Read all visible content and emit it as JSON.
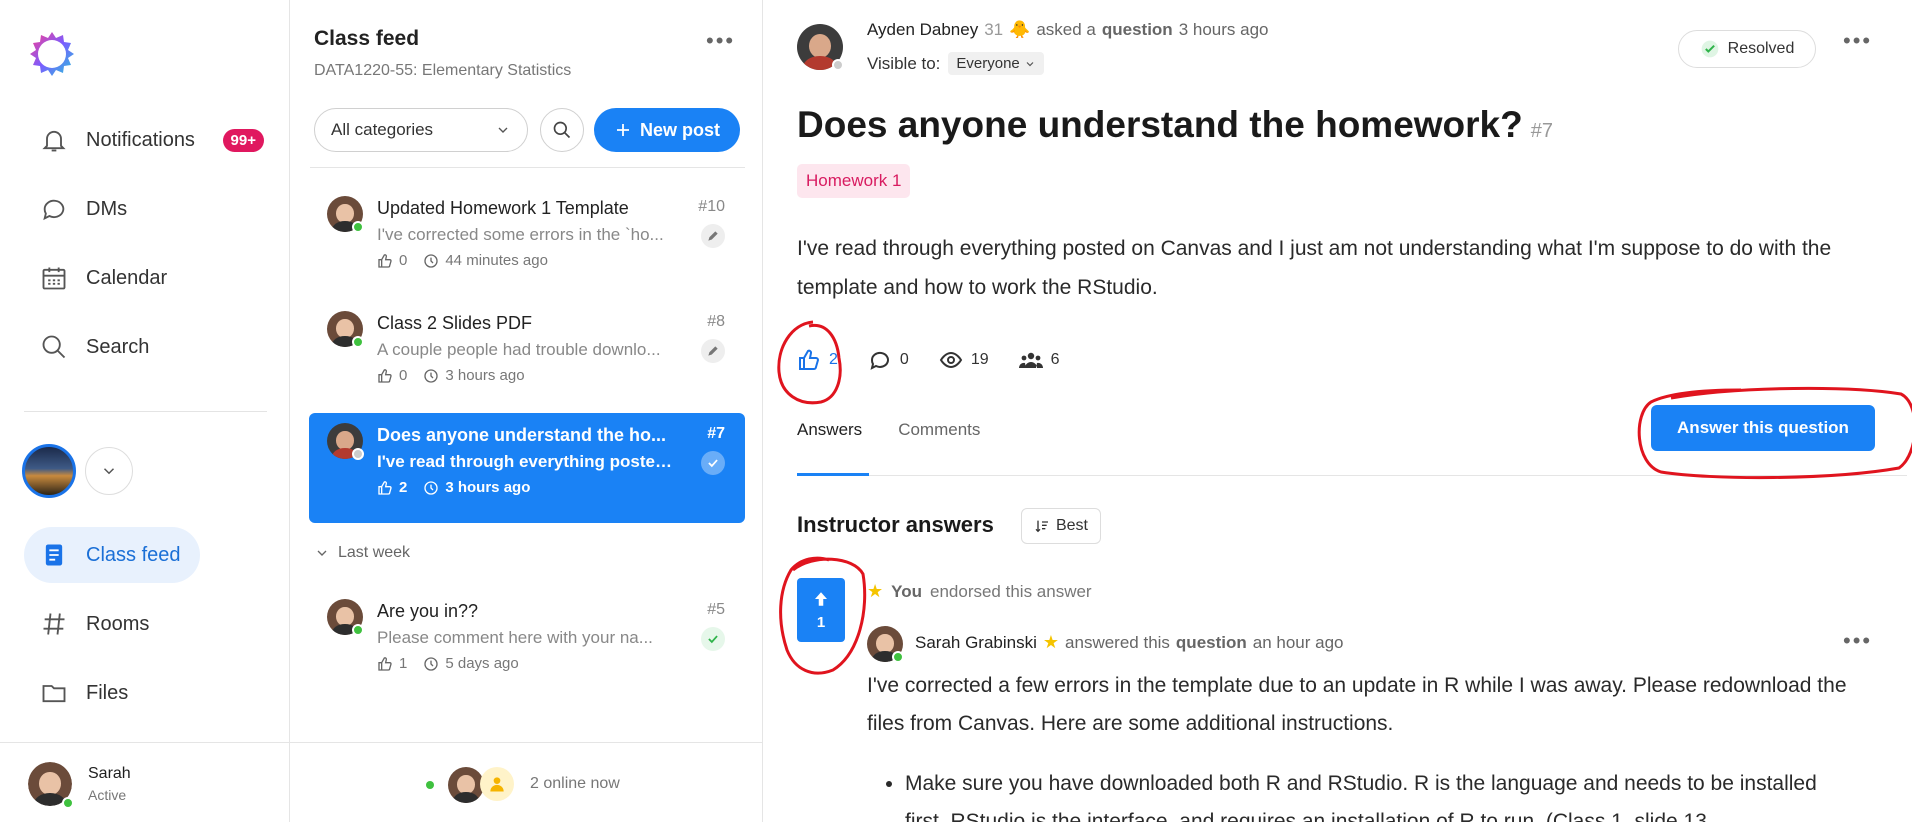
{
  "nav": {
    "items": [
      {
        "label": "Notifications",
        "badge": "99+"
      },
      {
        "label": "DMs"
      },
      {
        "label": "Calendar"
      },
      {
        "label": "Search"
      }
    ],
    "bottom_items": [
      {
        "label": "Class feed"
      },
      {
        "label": "Rooms"
      },
      {
        "label": "Files"
      }
    ],
    "user": {
      "name": "Sarah",
      "status": "Active"
    }
  },
  "feed": {
    "title": "Class feed",
    "course": "DATA1220-55: Elementary Statistics",
    "category_select": "All categories",
    "new_post_label": "New post",
    "posts": [
      {
        "title": "Updated Homework 1 Template",
        "num": "#10",
        "excerpt": "I've corrected some errors in the `ho...",
        "likes": "0",
        "time": "44 minutes ago"
      },
      {
        "title": "Class 2 Slides PDF",
        "num": "#8",
        "excerpt": "A couple people had trouble downlo...",
        "likes": "0",
        "time": "3 hours ago"
      },
      {
        "title": "Does anyone understand the ho...",
        "num": "#7",
        "excerpt": "I've read through everything posted ...",
        "likes": "2",
        "time": "3 hours ago"
      }
    ],
    "section_last_week": "Last week",
    "last_week_posts": [
      {
        "title": "Are you in??",
        "num": "#5",
        "excerpt": "Please comment here with your na...",
        "likes": "1",
        "time": "5 days ago"
      }
    ],
    "online_text": "2 online now"
  },
  "question": {
    "author": "Ayden Dabney",
    "author_count": "31",
    "asked_word": "asked a",
    "question_word": "question",
    "time": "3 hours ago",
    "visible_label": "Visible to:",
    "visible_value": "Everyone",
    "status": "Resolved",
    "title": "Does anyone understand the homework?",
    "num": "#7",
    "tag": "Homework 1",
    "body": "I've read through everything posted on Canvas and I just am not understanding what I'm suppose to do with the template and how to work the RStudio.",
    "stats": {
      "likes": "2",
      "comments": "0",
      "views": "19",
      "participants": "6"
    },
    "tabs": [
      "Answers",
      "Comments"
    ],
    "answer_button": "Answer this question"
  },
  "answers": {
    "section_title": "Instructor answers",
    "sort_label": "Best",
    "votes": "1",
    "endorse_who": "You",
    "endorse_text": "endorsed this answer",
    "author": "Sarah Grabinski",
    "answered_word": "answered this",
    "question_word": "question",
    "time": "an hour ago",
    "body": "I've corrected a few errors in the template due to an update in R while I was away. Please redownload the files from Canvas. Here are some additional instructions.",
    "bullet_1": "Make sure you have downloaded both R and RStudio. R is the language and needs to be installed first. RStudio is the interface, and requires an installation of R to run. (Class 1, slide 13"
  },
  "colors": {
    "accent": "#1a82f5",
    "badge": "#e0185f",
    "tag_text": "#d81b60",
    "annotation": "#e0141e"
  }
}
